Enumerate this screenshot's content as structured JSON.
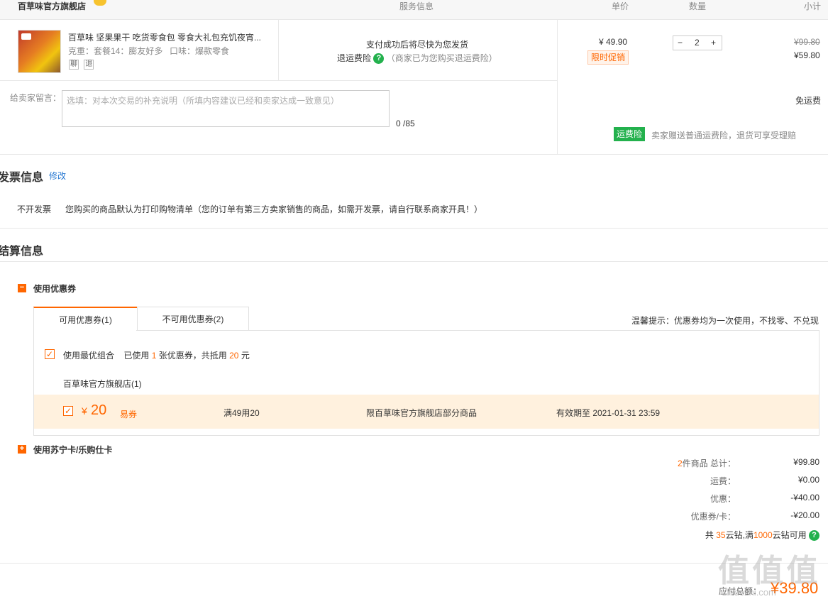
{
  "header": {
    "store": "百草味官方旗舰店",
    "service": "服务信息",
    "unit_price": "单价",
    "quantity": "数量",
    "subtotal": "小计"
  },
  "product": {
    "title": "百草味 坚果果干 吃货零食包 零食大礼包充饥夜宵...",
    "attr_weight": "克重：套餐14：膨友好多",
    "attr_flavor": "口味：爆款零食",
    "tag1": "聊",
    "tag2": "退",
    "service_line1": "支付成功后将尽快为您发货",
    "service_line2": "退运费险",
    "service_note": "（商家已为您购买退运费险）",
    "help_icon": "?",
    "price": "¥ 49.90",
    "promo": "限时促销",
    "qty": "2",
    "qty_minus": "−",
    "qty_plus": "+",
    "original_subtotal": "¥99.80",
    "subtotal": "¥59.80"
  },
  "message": {
    "label": "给卖家留言：",
    "placeholder": "选填：对本次交易的补充说明（所填内容建议已经和卖家达成一致意见）",
    "counter": "0 /85"
  },
  "shipping": {
    "free": "免运费",
    "badge": "运费险",
    "note": "卖家赠送普通运费险，退货可享受理赔"
  },
  "invoice": {
    "title": "发票信息",
    "edit": "修改",
    "type": "不开发票",
    "desc": "您购买的商品默认为打印购物清单（您的订单有第三方卖家销售的商品，如需开发票，请自行联系商家开具！）"
  },
  "settlement": {
    "title": "结算信息",
    "coupon_toggle": "使用优惠券",
    "toggle_minus": "−",
    "toggle_plus": "+",
    "tab_available": "可用优惠券(1)",
    "tab_unavailable": "不可用优惠券(2)",
    "tip": "温馨提示：优惠券均为一次使用，不找零、不兑现",
    "best_combo": "使用最优组合",
    "used_prefix": "已使用",
    "used_count": "1",
    "used_mid": "张优惠券，共抵用",
    "used_amount": "20",
    "used_suffix": "元",
    "store_group": "百草味官方旗舰店(1)",
    "coupon_currency": "¥",
    "coupon_amount": "20",
    "coupon_type": "易券",
    "coupon_rule": "满49用20",
    "coupon_scope": "限百草味官方旗舰店部分商品",
    "coupon_expiry": "有效期至 2021-01-31 23:59",
    "card_toggle": "使用苏宁卡/乐购仕卡",
    "check": "✓"
  },
  "summary": {
    "items_count": "2",
    "items_label": "件商品 总计：",
    "total": "¥99.80",
    "shipping_label": "运费：",
    "shipping": "¥0.00",
    "discount_label": "优惠：",
    "discount": "-¥40.00",
    "coupon_label": "优惠券/卡：",
    "coupon": "-¥20.00",
    "cloud_prefix": "共",
    "cloud_count": "35",
    "cloud_mid": "云钻,满",
    "cloud_min": "1000",
    "cloud_suffix": "云钻可用",
    "payable_label": "应付总额：",
    "payable": "¥39.80",
    "watermark": "值 值 值",
    "watermark_url": "zhidezhi.com"
  }
}
